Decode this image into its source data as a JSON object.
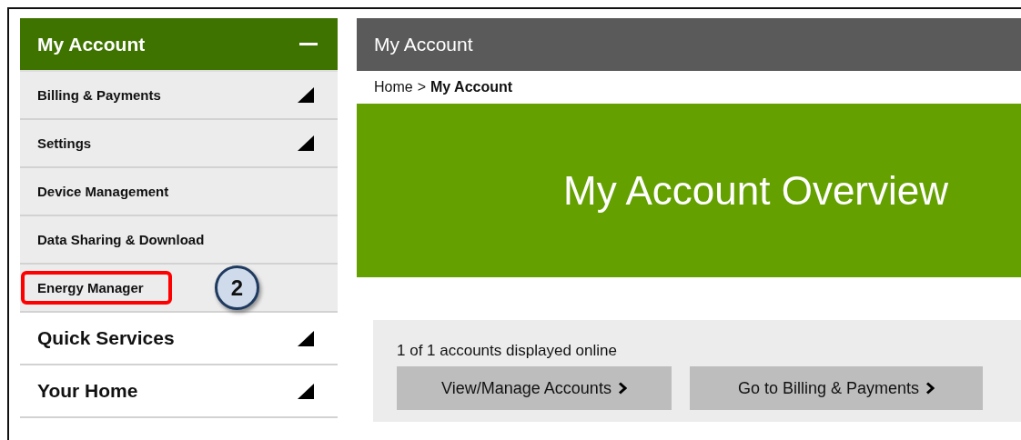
{
  "sidebar": {
    "header": {
      "title": "My Account",
      "expanded": true
    },
    "items": [
      {
        "label": "Billing & Payments",
        "expandable": true,
        "highlighted": false
      },
      {
        "label": "Settings",
        "expandable": true,
        "highlighted": false
      },
      {
        "label": "Device Management",
        "expandable": false,
        "highlighted": false
      },
      {
        "label": "Data Sharing & Download",
        "expandable": false,
        "highlighted": false
      },
      {
        "label": "Energy Manager",
        "expandable": false,
        "highlighted": true
      }
    ],
    "sections": [
      {
        "label": "Quick Services",
        "expandable": true
      },
      {
        "label": "Your Home",
        "expandable": true
      }
    ]
  },
  "callout": {
    "label": "2"
  },
  "main": {
    "header": {
      "title": "My Account"
    },
    "breadcrumb": [
      {
        "label": "Home",
        "current": false
      },
      {
        "label": ">",
        "current": false
      },
      {
        "label": "My Account",
        "current": true
      }
    ],
    "banner": {
      "title": "My Account Overview"
    },
    "accounts": {
      "summary": "1 of 1 accounts displayed online",
      "buttons": [
        {
          "label": "View/Manage Accounts"
        },
        {
          "label": "Go to Billing & Payments"
        }
      ]
    }
  }
}
